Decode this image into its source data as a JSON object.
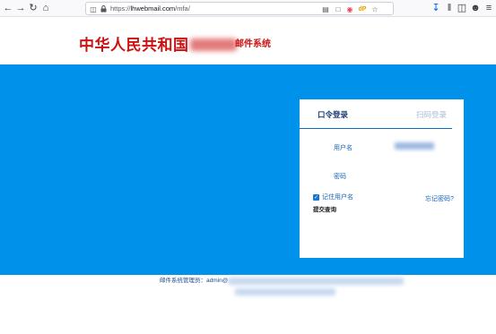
{
  "browser": {
    "url_scheme": "https://",
    "url_host": "lhwebmail.com",
    "url_path": "/mfa/",
    "icons": [
      "back-icon",
      "forward-icon",
      "reload-icon",
      "home-icon",
      "shield-icon",
      "lock-icon",
      "reader-view-icon",
      "pocket-icon",
      "download-icon",
      "library-icon",
      "sidebar-icon",
      "account-icon",
      "menu-icon"
    ],
    "dp_label": "dP"
  },
  "header": {
    "brand_title": "中华人民共和国",
    "subtitle": "邮件系统"
  },
  "login": {
    "tab_password": "口令登录",
    "tab_qr": "扫码登录",
    "username_label": "用户名",
    "password_label": "密码",
    "remember_label": "记住用户名",
    "forgot_link": "忘记密码?",
    "submit_label": "提交查询",
    "remember_checked": true
  },
  "footer": {
    "admin_text": "邮件系统管理员：admin@"
  },
  "colors": {
    "brand_red": "#cc1111",
    "hero_blue": "#0091ea",
    "link_blue": "#1565c0"
  }
}
